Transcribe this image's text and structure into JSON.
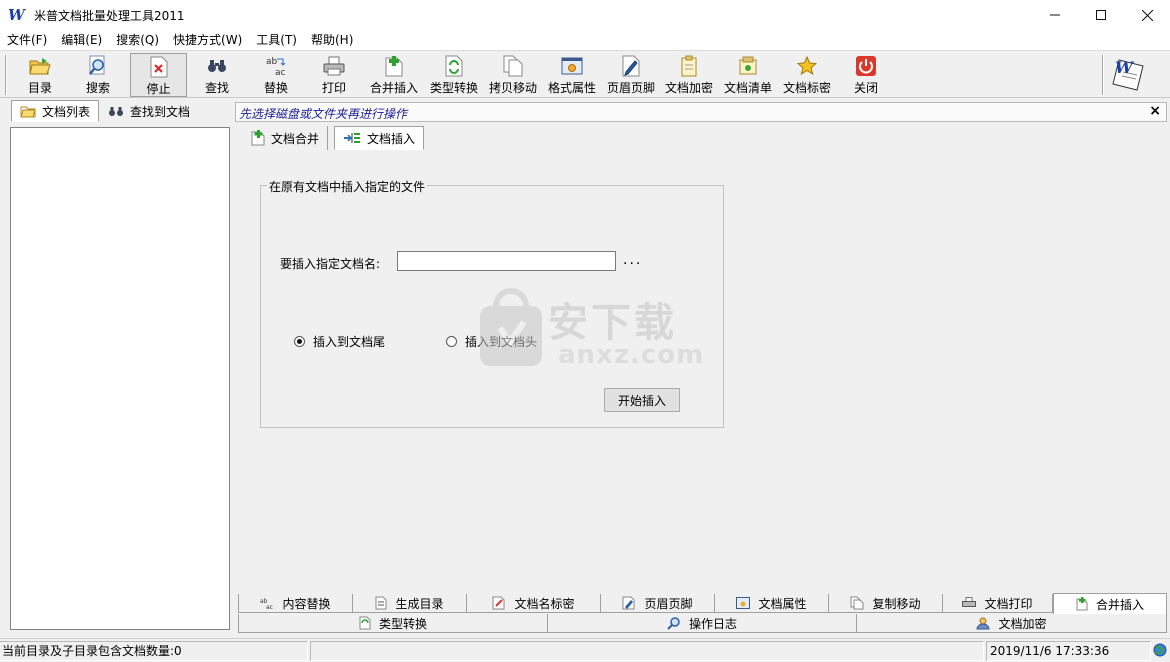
{
  "window": {
    "title": "米普文档批量处理工具2011",
    "app_icon_letter": "W"
  },
  "menu": [
    "文件(F)",
    "编辑(E)",
    "搜索(Q)",
    "快捷方式(W)",
    "工具(T)",
    "帮助(H)"
  ],
  "toolbar": {
    "dir": "目录",
    "search": "搜索",
    "stop": "停止",
    "find": "查找",
    "replace": "替换",
    "print": "打印",
    "merge_insert": "合并插入",
    "type_convert": "类型转换",
    "copy_move": "拷贝移动",
    "format_props": "格式属性",
    "header_footer": "页眉页脚",
    "encrypt": "文档加密",
    "doc_list": "文档清单",
    "doc_mark": "文档标密",
    "close": "关闭"
  },
  "left_panel": {
    "tabs": [
      "文档列表",
      "查找到文档"
    ]
  },
  "right_panel": {
    "hint": "先选择磁盘或文件夹再进行操作",
    "close_glyph": "×",
    "tabs": [
      "文档合并",
      "文档插入"
    ],
    "group_title": "在原有文档中插入指定的文件",
    "field_label": "要插入指定文档名:",
    "field_value": "",
    "browse_label": "...",
    "radio_tail": "插入到文档尾",
    "radio_head": "插入到文档头",
    "start_button": "开始插入"
  },
  "watermark": {
    "text": "安下载",
    "sub": "anxz.com"
  },
  "bottom_tabs_row1": [
    "内容替换",
    "生成目录",
    "文档名标密",
    "页眉页脚",
    "文档属性",
    "复制移动",
    "文档打印",
    "合并插入"
  ],
  "bottom_tabs_row2": [
    "类型转换",
    "操作日志",
    "文档加密"
  ],
  "status": {
    "count_text": "当前目录及子目录包含文档数量:0",
    "datetime": "2019/11/6 17:33:36"
  },
  "colors": {
    "hint_text": "#1c1c9a",
    "app_icon": "#1a3fa8",
    "close_icon_red": "#d9382b"
  }
}
